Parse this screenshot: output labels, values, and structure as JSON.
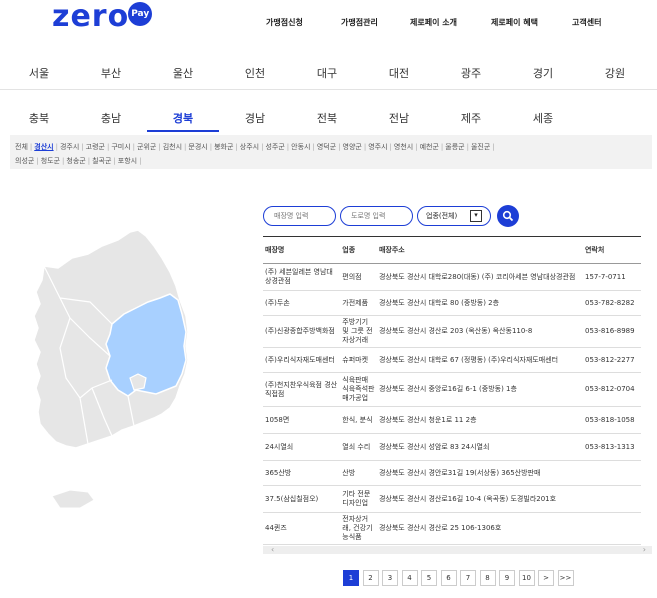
{
  "brand": {
    "logo_main": "zero",
    "logo_badge": "Pay"
  },
  "topnav": [
    "가맹점신청",
    "가맹점관리",
    "제로페이 소개",
    "제로페이 혜택",
    "고객센터"
  ],
  "regions_row1": [
    "서울",
    "부산",
    "울산",
    "인천",
    "대구",
    "대전",
    "광주",
    "경기",
    "강원"
  ],
  "regions_row2": [
    "충북",
    "충남",
    "경북",
    "경남",
    "전북",
    "전남",
    "제주",
    "세종"
  ],
  "active_region": "경북",
  "districts_line1": [
    "전체",
    "경산시",
    "경주시",
    "고령군",
    "구미시",
    "군위군",
    "김천시",
    "문경시",
    "봉화군",
    "상주시",
    "성주군",
    "안동시",
    "영덕군",
    "영양군",
    "영주시",
    "영천시",
    "예천군",
    "울릉군",
    "울진군"
  ],
  "districts_line2": [
    "의성군",
    "청도군",
    "청송군",
    "칠곡군",
    "포항시"
  ],
  "active_district": "경산시",
  "search": {
    "store_placeholder": "매장명 입력",
    "road_placeholder": "도로명 입력",
    "category_label": "업종(전체)"
  },
  "table": {
    "headers": [
      "매장명",
      "업종",
      "매장주소",
      "연락처"
    ],
    "rows": [
      [
        "(주) 세븐일레븐 영남대상경관점",
        "편의점",
        "경상북도 경산시 대학로280(대동) (주) 코리아세븐 영남대상경관점",
        "157-7-0711"
      ],
      [
        "(주)두손",
        "가전제품",
        "경상북도 경산시 대학로 80 (중방동) 2층",
        "053-782-8282"
      ],
      [
        "(주)신광종합주방백화점",
        "주방기기 및 그릇 전자상거래",
        "경상북도 경산시 경산로 203 (옥산동) 옥산동110-8",
        "053-816-8989"
      ],
      [
        "(주)우리식자재도매센터",
        "슈퍼마켓",
        "경상북도 경산시 대학로 67 (정평동) (주)우리식자재도매센터",
        "053-812-2277"
      ],
      [
        "(주)천지찬우식육점 경산직접점",
        "식육판매 식육즉석판매가공업",
        "경상북도 경산시 중앙로16길 6-1 (중방동) 1층",
        "053-812-0704"
      ],
      [
        "1058면",
        "한식, 분식",
        "경상북도 경산시 청운1로 11 2층",
        "053-818-1058"
      ],
      [
        "24시열쇠",
        "열쇠 수리",
        "경상북도 경산시 성암로 83 24시열쇠",
        "053-813-1313"
      ],
      [
        "365산방",
        "산방",
        "경상북도 경산시 경안로31길 19(서상동) 365산방판매",
        ""
      ],
      [
        "37.5(삼십칠점오)",
        "기타 전문 디자인업",
        "경상북도 경산시 경산로16길 10-4 (옥곡동) 도경빌라201호",
        ""
      ],
      [
        "44퀸즈",
        "전자상거래, 건강기능식품",
        "경상북도 경산시 경산로 25 106-1306호",
        ""
      ]
    ]
  },
  "pagination": {
    "pages": [
      "1",
      "2",
      "3",
      "4",
      "5",
      "6",
      "7",
      "8",
      "9",
      "10"
    ],
    "current": "1",
    "next": ">",
    "last": ">>"
  },
  "colors": {
    "accent": "#1d3ed6",
    "map_land": "#e6e6e6",
    "map_highlight": "#a8d0ff"
  }
}
